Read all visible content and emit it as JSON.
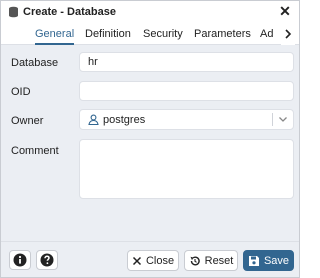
{
  "dialog": {
    "title": "Create - Database",
    "tabs": [
      {
        "label": "General",
        "active": true
      },
      {
        "label": "Definition",
        "active": false
      },
      {
        "label": "Security",
        "active": false
      },
      {
        "label": "Parameters",
        "active": false
      },
      {
        "label": "Ad",
        "active": false
      }
    ]
  },
  "form": {
    "database": {
      "label": "Database",
      "value": "hr"
    },
    "oid": {
      "label": "OID",
      "value": ""
    },
    "owner": {
      "label": "Owner",
      "value": "postgres"
    },
    "comment": {
      "label": "Comment",
      "value": ""
    }
  },
  "footer": {
    "close_label": "Close",
    "reset_label": "Reset",
    "save_label": "Save"
  },
  "colors": {
    "accent": "#326690",
    "dialog_bg": "#ebeef3"
  }
}
